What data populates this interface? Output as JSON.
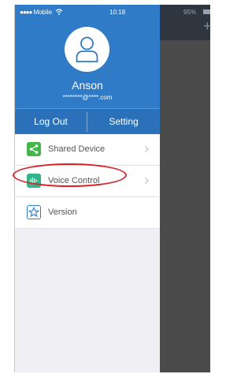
{
  "status_bar": {
    "signal": "●●●●",
    "carrier": "Mobile",
    "time": "10:18"
  },
  "profile": {
    "name": "Anson",
    "email": "********@****.com"
  },
  "buttons": {
    "logout": "Log Out",
    "setting": "Setting"
  },
  "menu": {
    "items": [
      {
        "label": "Shared Device",
        "icon": "share-icon",
        "color": "#43b649"
      },
      {
        "label": "Voice Control",
        "icon": "voice-wave-icon",
        "color": "#33b58a"
      },
      {
        "label": "Version",
        "icon": "star-icon",
        "color": "#2f7bc8"
      }
    ]
  },
  "background_page": {
    "battery": "95%",
    "add": "+"
  },
  "colors": {
    "header": "#2f7bc8",
    "highlight": "#d8232a"
  }
}
